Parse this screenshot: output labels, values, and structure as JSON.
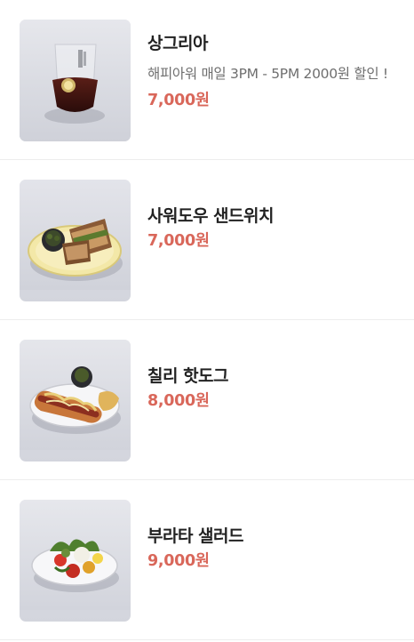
{
  "menu": {
    "items": [
      {
        "name": "상그리아",
        "description": "해피아워 매일 3PM - 5PM 2000원 할인 !",
        "price": "7,000원",
        "image_icon": "sangria-glass-image"
      },
      {
        "name": "사워도우 샌드위치",
        "description": "",
        "price": "7,000원",
        "image_icon": "sandwich-plate-image"
      },
      {
        "name": "칠리 핫도그",
        "description": "",
        "price": "8,000원",
        "image_icon": "hotdog-plate-image"
      },
      {
        "name": "부라타 샐러드",
        "description": "",
        "price": "9,000원",
        "image_icon": "salad-plate-image"
      }
    ]
  },
  "colors": {
    "price": "#d9675a",
    "title": "#222222",
    "description": "#6f6f6f",
    "divider": "#ededed"
  }
}
